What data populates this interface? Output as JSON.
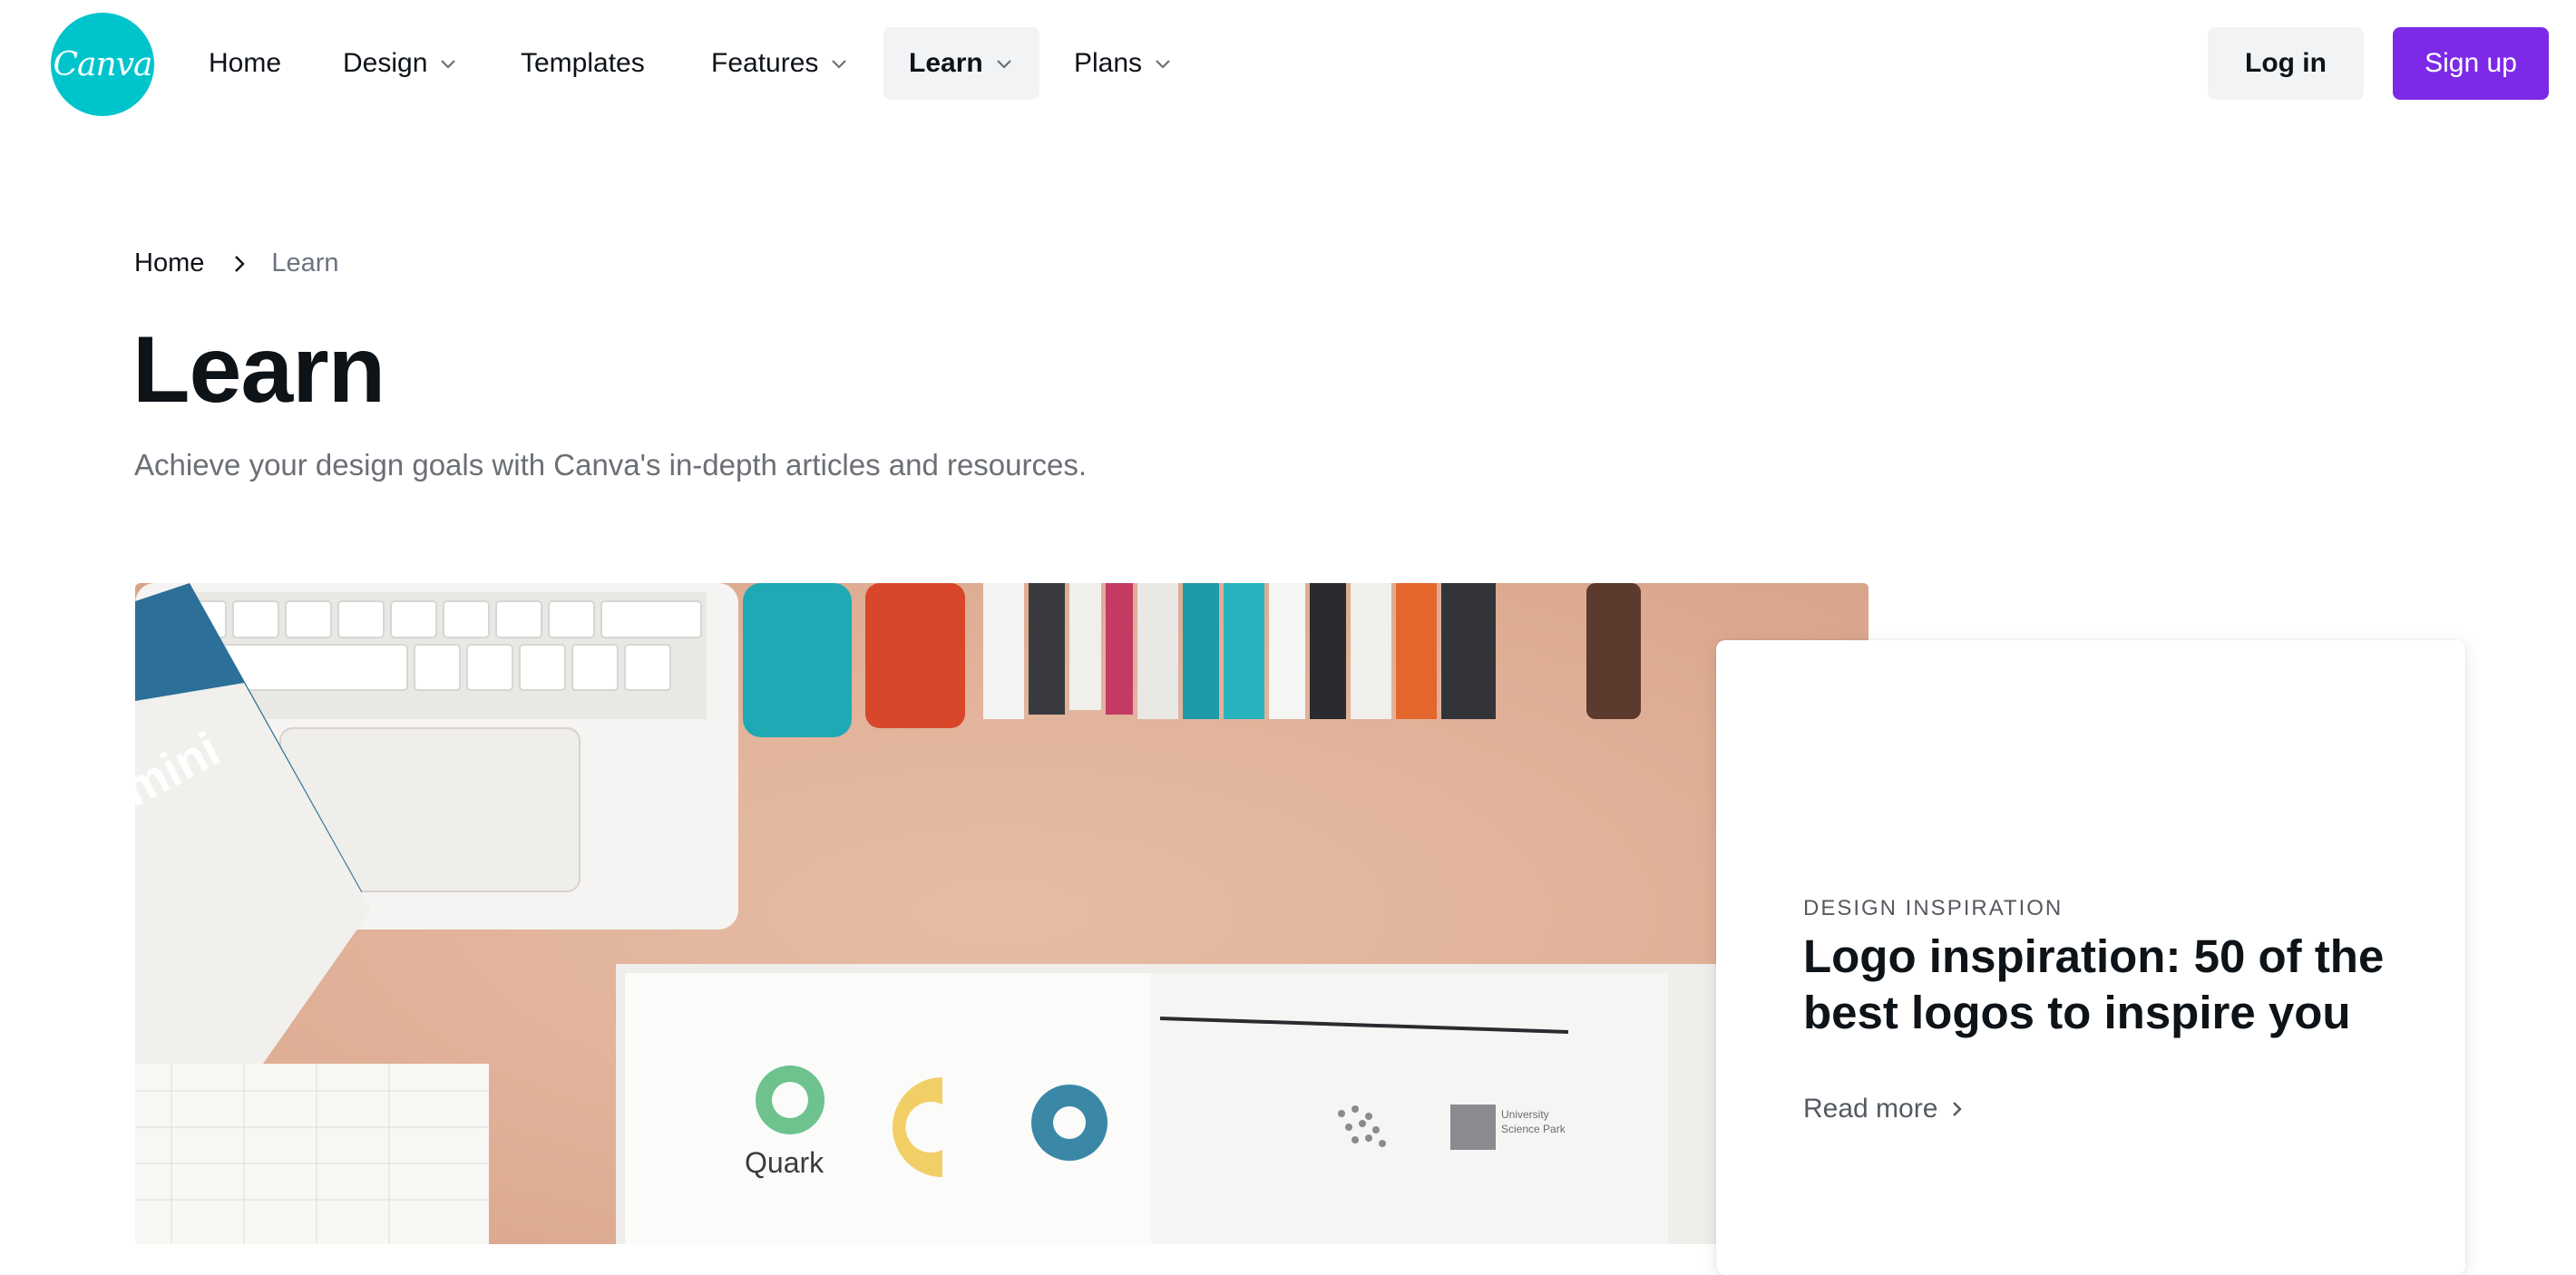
{
  "logo": {
    "text": "Canva"
  },
  "nav": {
    "home": "Home",
    "design": "Design",
    "templates": "Templates",
    "features": "Features",
    "learn": "Learn",
    "plans": "Plans",
    "login": "Log in",
    "signup": "Sign up"
  },
  "breadcrumb": {
    "home": "Home",
    "current": "Learn"
  },
  "page": {
    "title": "Learn",
    "subtitle": "Achieve your design goals with Canva's in-depth articles and resources."
  },
  "feature": {
    "category": "DESIGN INSPIRATION",
    "title": "Logo inspiration: 50 of the best logos to inspire you",
    "link": "Read more"
  },
  "hero_image": {
    "visible_text": [
      "mini",
      "Quark",
      "University Science Park"
    ]
  },
  "colors": {
    "brand_teal": "#00c4cc",
    "signup_purple": "#7d2ae8",
    "button_gray": "#f2f3f5"
  },
  "icons": [
    "chevron-down-icon",
    "chevron-right-icon"
  ]
}
